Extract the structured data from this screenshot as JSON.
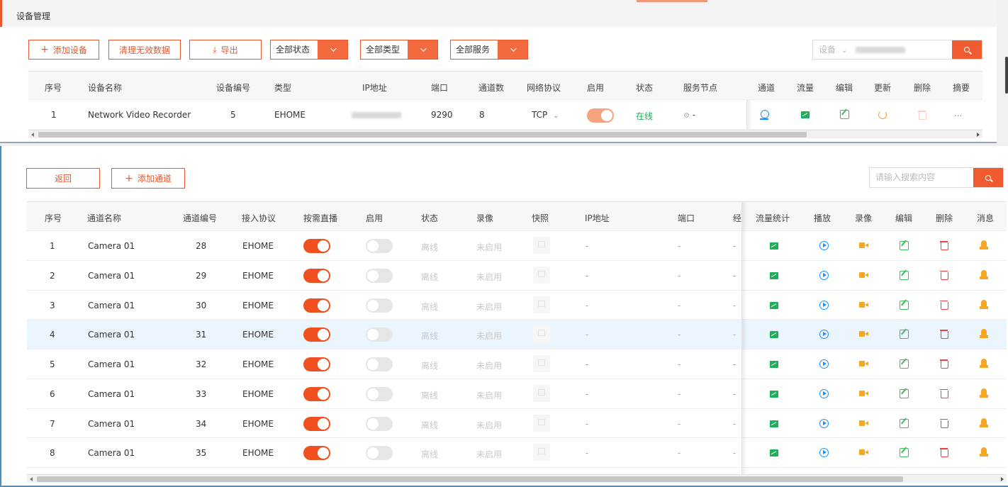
{
  "device_page": {
    "title": "设备管理",
    "toolbar": {
      "add_label": "添加设备",
      "clear_label": "清理无效数据",
      "export_label": "导出",
      "status_filter": "全部状态",
      "type_filter": "全部类型",
      "service_filter": "全部服务",
      "search_scope": "设备"
    },
    "columns": [
      "序号",
      "设备名称",
      "设备编号",
      "类型",
      "IP地址",
      "端口",
      "通道数",
      "网络协议",
      "启用",
      "状态",
      "服务节点",
      "通道",
      "流量",
      "编辑",
      "更新",
      "删除",
      "摘要"
    ],
    "rows": [
      {
        "index": "1",
        "name": "Network Video Recorder",
        "code": "5",
        "type": "EHOME",
        "port": "9290",
        "channels": "8",
        "protocol": "TCP",
        "enabled": true,
        "status": "在线",
        "service_node": "-",
        "summary": "..."
      }
    ]
  },
  "channel_page": {
    "toolbar": {
      "back_label": "返回",
      "add_label": "添加通道",
      "search_placeholder": "请输入搜索内容"
    },
    "columns": [
      "序号",
      "通道名称",
      "通道编号",
      "接入协议",
      "按需直播",
      "启用",
      "状态",
      "录像",
      "快照",
      "IP地址",
      "端口",
      "经",
      "流量统计",
      "播放",
      "录像",
      "编辑",
      "删除",
      "消息"
    ],
    "rows": [
      {
        "index": "1",
        "name": "Camera 01",
        "code": "28",
        "protocol": "EHOME",
        "on_demand": true,
        "enabled": false,
        "status": "离线",
        "record": "未启用",
        "ip": "-",
        "port": "-",
        "extra": "-"
      },
      {
        "index": "2",
        "name": "Camera 01",
        "code": "29",
        "protocol": "EHOME",
        "on_demand": true,
        "enabled": false,
        "status": "离线",
        "record": "未启用",
        "ip": "-",
        "port": "-",
        "extra": "-"
      },
      {
        "index": "3",
        "name": "Camera 01",
        "code": "30",
        "protocol": "EHOME",
        "on_demand": true,
        "enabled": false,
        "status": "离线",
        "record": "未启用",
        "ip": "-",
        "port": "-",
        "extra": "-"
      },
      {
        "index": "4",
        "name": "Camera 01",
        "code": "31",
        "protocol": "EHOME",
        "on_demand": true,
        "enabled": false,
        "status": "离线",
        "record": "未启用",
        "ip": "-",
        "port": "-",
        "extra": "-"
      },
      {
        "index": "5",
        "name": "Camera 01",
        "code": "32",
        "protocol": "EHOME",
        "on_demand": true,
        "enabled": false,
        "status": "离线",
        "record": "未启用",
        "ip": "-",
        "port": "-",
        "extra": "-"
      },
      {
        "index": "6",
        "name": "Camera 01",
        "code": "33",
        "protocol": "EHOME",
        "on_demand": true,
        "enabled": false,
        "status": "离线",
        "record": "未启用",
        "ip": "-",
        "port": "-",
        "extra": "-"
      },
      {
        "index": "7",
        "name": "Camera 01",
        "code": "34",
        "protocol": "EHOME",
        "on_demand": true,
        "enabled": false,
        "status": "离线",
        "record": "未启用",
        "ip": "-",
        "port": "-",
        "extra": "-"
      },
      {
        "index": "8",
        "name": "Camera 01",
        "code": "35",
        "protocol": "EHOME",
        "on_demand": true,
        "enabled": false,
        "status": "离线",
        "record": "未启用",
        "ip": "-",
        "port": "-",
        "extra": "-"
      }
    ],
    "highlighted_row": "4"
  },
  "colors": {
    "accent": "#e8572d",
    "accent_fill": "#f26a3e",
    "online": "#1fae5a",
    "muted": "#c8c8c8",
    "row_highlight": "#ebf5fd"
  }
}
